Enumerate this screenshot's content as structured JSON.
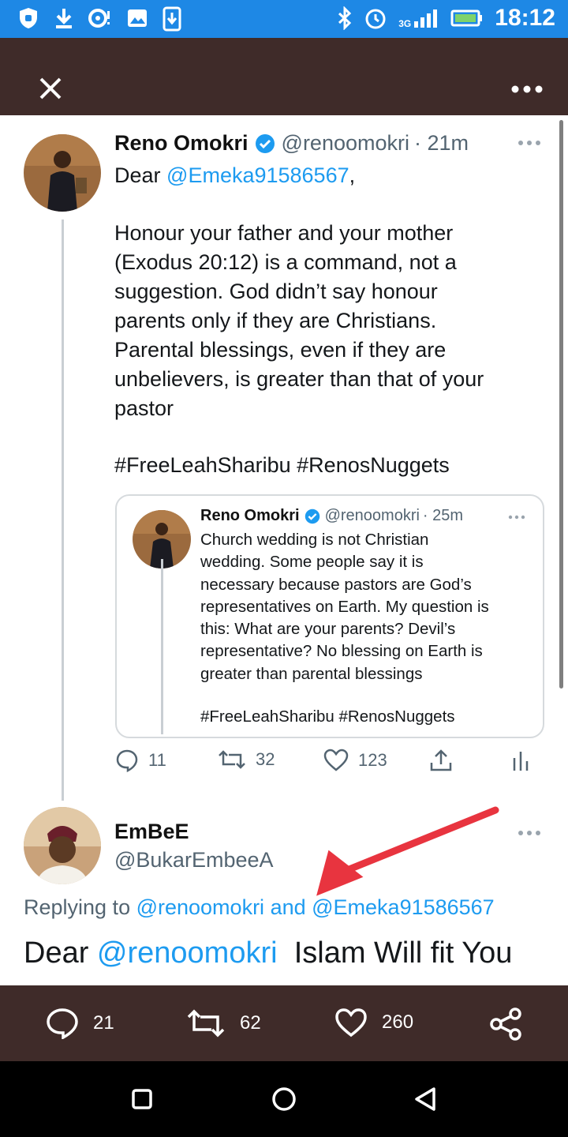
{
  "status_bar": {
    "time": "18:12",
    "network": "3G",
    "icons": [
      "shield-icon",
      "download-icon",
      "hotspot-icon",
      "gallery-icon",
      "download-box-icon",
      "bluetooth-icon",
      "alarm-icon",
      "signal-icon",
      "battery-icon"
    ]
  },
  "toolbar": {
    "close_icon": "close-icon",
    "more_icon": "more-icon"
  },
  "tweet": {
    "author_name": "Reno Omokri",
    "author_handle": "@renoomokri",
    "time": "· 21m",
    "greeting": "Dear ",
    "greeting_mention": "@Emeka91586567",
    "greeting_comma": ",",
    "body_lines": [
      "Honour your father and your mother",
      "(Exodus 20:12) is a command, not a",
      "suggestion. God didn’t say honour",
      "parents only if they are Christians.",
      "Parental blessings, even if they are",
      "unbelievers, is greater than that of your",
      "pastor"
    ],
    "hashtags": "#FreeLeahSharibu #RenosNuggets",
    "quoted": {
      "author_name": "Reno Omokri",
      "author_handle": "@renoomokri",
      "time": "· 25m",
      "body_lines": [
        "Church wedding is not Christian",
        "wedding. Some people say it is",
        "necessary because pastors are God’s",
        "representatives on Earth. My question is",
        "this: What are your parents? Devil’s",
        "representative? No blessing on Earth is",
        "greater than parental blessings"
      ],
      "hashtags": "#FreeLeahSharibu #RenosNuggets"
    },
    "replies": "11",
    "retweets": "32",
    "likes": "123"
  },
  "reply": {
    "author_name": "EmBeE",
    "author_handle": "@BukarEmbeeA",
    "replying_prefix": "Replying to ",
    "replying_mention1": "@renoomokri",
    "replying_and": " and ",
    "replying_mention2": "@Emeka91586567",
    "text_prefix": "Dear ",
    "text_mention": "@renoomokri",
    "text_rest": "  Islam Will fit You"
  },
  "bottom_bar": {
    "comments": "21",
    "retweets": "62",
    "likes": "260"
  },
  "colors": {
    "accent": "#1d9bf0",
    "status_bar": "#1e88e5",
    "toolbar": "#3f2b29",
    "arrow": "#e8343f"
  }
}
